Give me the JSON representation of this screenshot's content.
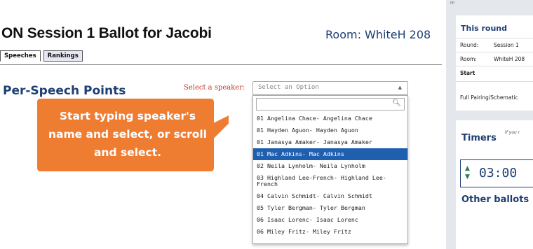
{
  "page": {
    "title": "ON Session 1 Ballot for Jacobi",
    "room": "Room: WhiteH 208",
    "tabs": [
      "Speeches",
      "Rankings"
    ],
    "section_title": "Per-Speech Points",
    "select_label": "Select a speaker:"
  },
  "select": {
    "placeholder": "Select an Option",
    "options": [
      "01 Angelina Chace- Angelina Chace",
      "01 Hayden Aguon- Hayden Aguon",
      "01 Janasya Amaker- Janasya Amaker",
      "01 Mac Adkins- Mac Adkins",
      "02 Neila Lynholm- Neila Lynholm",
      "03 Highland Lee-French- Highland Lee-French",
      "04 Calvin Schmidt- Calvin Schmidt",
      "05 Tyler Bergman- Tyler Bergman",
      "06 Isaac Lorenc- Isaac Lorenc",
      "06 Miley Fritz- Miley Fritz"
    ],
    "highlighted_index": 3
  },
  "callout": {
    "text": "Start typing speaker's name and select, or scroll and select.",
    "color": "#ee7d32"
  },
  "side": {
    "corner_mark": "PP",
    "round_title": "This round",
    "round_label": "Round:",
    "round_value": "Session 1",
    "room_label": "Room:",
    "room_value": "WhiteH 208",
    "start_label": "Start",
    "pairing_link": "Full Pairing/Schematic",
    "timers_title": "Timers",
    "timers_note": "If you r",
    "timer_value": "03:00",
    "other_ballots": "Other ballots"
  },
  "colors": {
    "accent": "#1d3f73",
    "highlight": "#1f5faf",
    "label_red": "#c0392b",
    "panel_bg": "#e4e8ec"
  }
}
